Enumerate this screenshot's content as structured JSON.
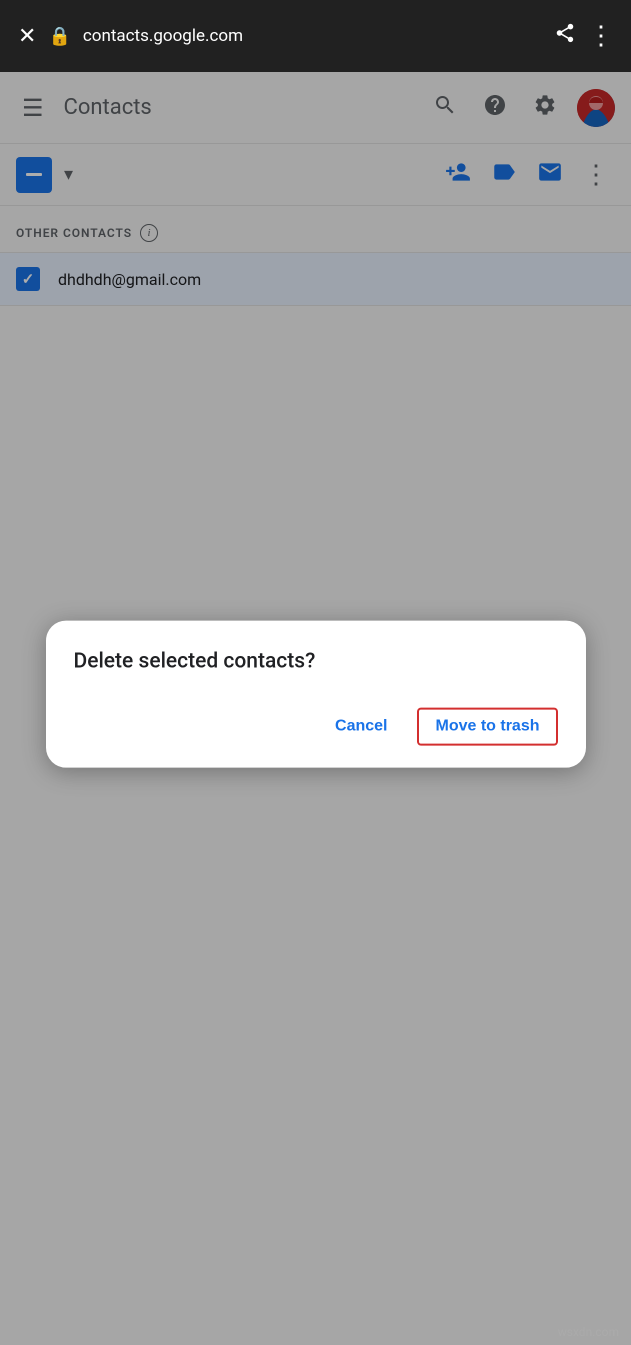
{
  "browser": {
    "url": "contacts.google.com",
    "close_icon": "✕",
    "lock_icon": "🔒",
    "share_icon": "⋮",
    "menu_icon": "⋮"
  },
  "app_bar": {
    "menu_icon": "☰",
    "title": "Contacts",
    "search_icon": "🔍",
    "help_icon": "?",
    "settings_icon": "⚙"
  },
  "toolbar": {
    "add_contact_icon": "+person",
    "label_icon": "label",
    "email_icon": "✉",
    "more_icon": "⋮"
  },
  "section": {
    "header": "OTHER CONTACTS",
    "info_icon": "i"
  },
  "contact": {
    "email": "dhdhdh@gmail.com"
  },
  "dialog": {
    "title": "Delete selected contacts?",
    "cancel_label": "Cancel",
    "confirm_label": "Move to trash"
  },
  "watermark": "wsxdn.com",
  "colors": {
    "blue": "#1a73e8",
    "red_border": "#d32f2f",
    "dark_text": "#202124",
    "grey_text": "#5f6368"
  }
}
